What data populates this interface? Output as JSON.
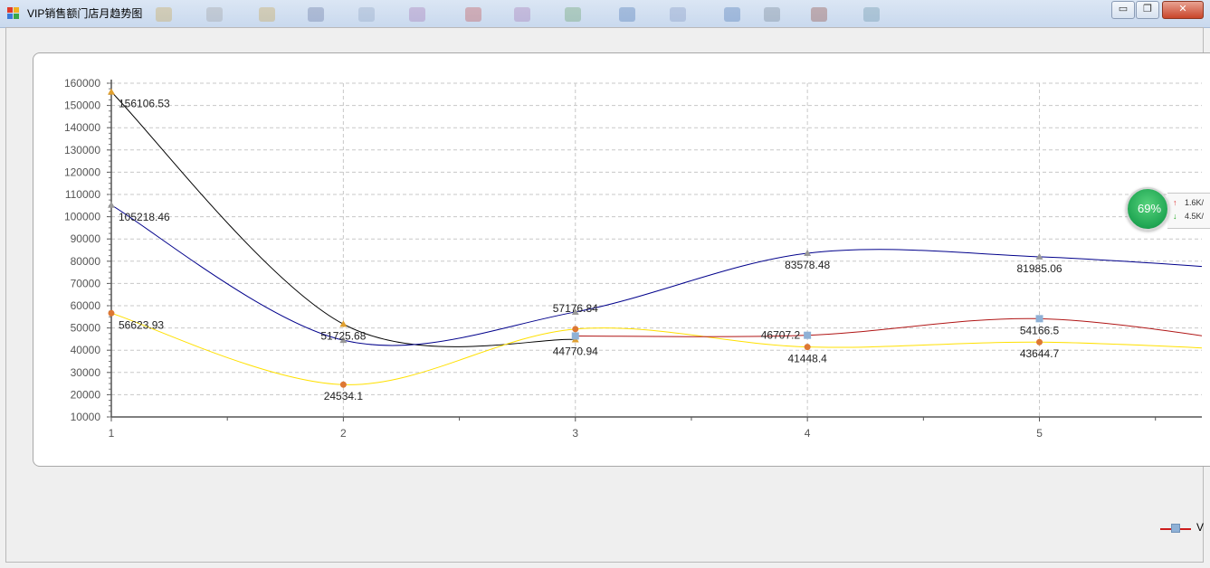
{
  "window": {
    "title": "VIP销售额门店月趋势图",
    "minimize_glyph": "▭",
    "maximize_glyph": "❐",
    "close_glyph": "✕"
  },
  "network_widget": {
    "percent": "69%",
    "upload": "1.6K/",
    "download": "4.5K/"
  },
  "legend": {
    "entry": "V"
  },
  "chart_data": {
    "type": "line",
    "x": [
      1,
      2,
      3,
      4,
      5,
      6
    ],
    "xlim": [
      1,
      5.7
    ],
    "ylim": [
      10000,
      160000
    ],
    "y_ticks": [
      10000,
      20000,
      30000,
      40000,
      50000,
      60000,
      70000,
      80000,
      90000,
      100000,
      110000,
      120000,
      130000,
      140000,
      150000,
      160000
    ],
    "x_ticks": [
      1,
      2,
      3,
      4,
      5
    ],
    "grid": true,
    "series": [
      {
        "color": "#000000",
        "marker_color": "#e0a030",
        "marker": "triangle",
        "x": [
          1,
          2,
          3
        ],
        "values": [
          156106.53,
          51725.68,
          44770.94
        ],
        "labels": [
          "156106.53",
          "51725.68",
          "44770.94"
        ]
      },
      {
        "color": "#00008b",
        "marker_color": "#999999",
        "marker": "triangle",
        "x": [
          1,
          2,
          3,
          4,
          5,
          6
        ],
        "values": [
          105218.46,
          44500,
          57176.84,
          83578.48,
          81985.06,
          75500
        ],
        "labels": [
          "105218.46",
          "",
          "57176.84",
          "83578.48",
          "81985.06",
          ""
        ]
      },
      {
        "color": "#ffe000",
        "marker_color": "#dd7733",
        "marker": "circle",
        "x": [
          1,
          2,
          3,
          4,
          5,
          6
        ],
        "values": [
          56623.93,
          24534.1,
          49500,
          41448.4,
          43644.7,
          39500
        ],
        "labels": [
          "56623.93",
          "24534.1",
          "",
          "41448.4",
          "43644.7",
          ""
        ]
      },
      {
        "color": "#b01515",
        "marker_color": "#8fb1d6",
        "marker": "square",
        "x": [
          3,
          4,
          5,
          6
        ],
        "values": [
          46400,
          46707.2,
          54166.5,
          42000
        ],
        "labels": [
          "",
          "46707.2",
          "54166.5",
          ""
        ]
      }
    ]
  }
}
